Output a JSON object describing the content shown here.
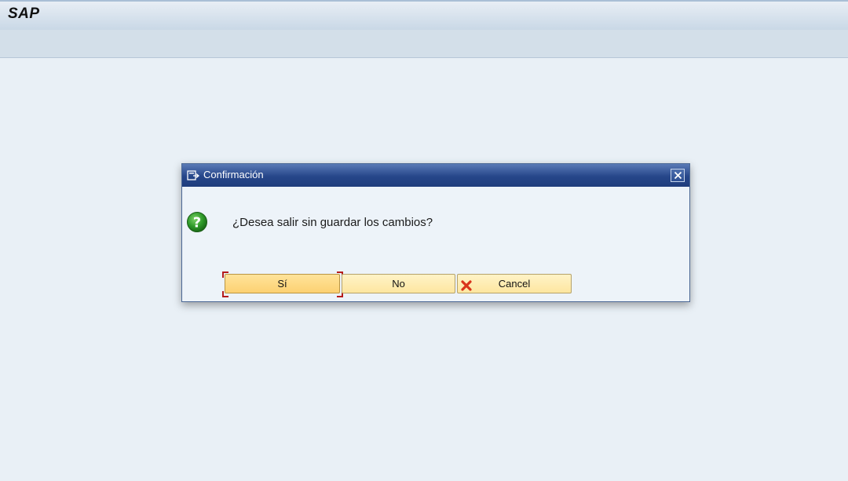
{
  "app": {
    "brand": "SAP"
  },
  "dialog": {
    "title": "Confirmación",
    "message": "¿Desea salir sin guardar los cambios?",
    "buttons": {
      "yes": "Sí",
      "no": "No",
      "cancel": "Cancel"
    },
    "icons": {
      "title": "dialog-window-icon",
      "close": "close-icon",
      "message": "question-icon",
      "cancel": "cancel-x-icon"
    },
    "colors": {
      "title_bar": "#26468a",
      "button_face": "#fde6a0",
      "default_button_face": "#fcd172",
      "focus_marker": "#b51b1b",
      "question_icon": "#2f9a2a",
      "cancel_icon": "#d9331a"
    }
  }
}
